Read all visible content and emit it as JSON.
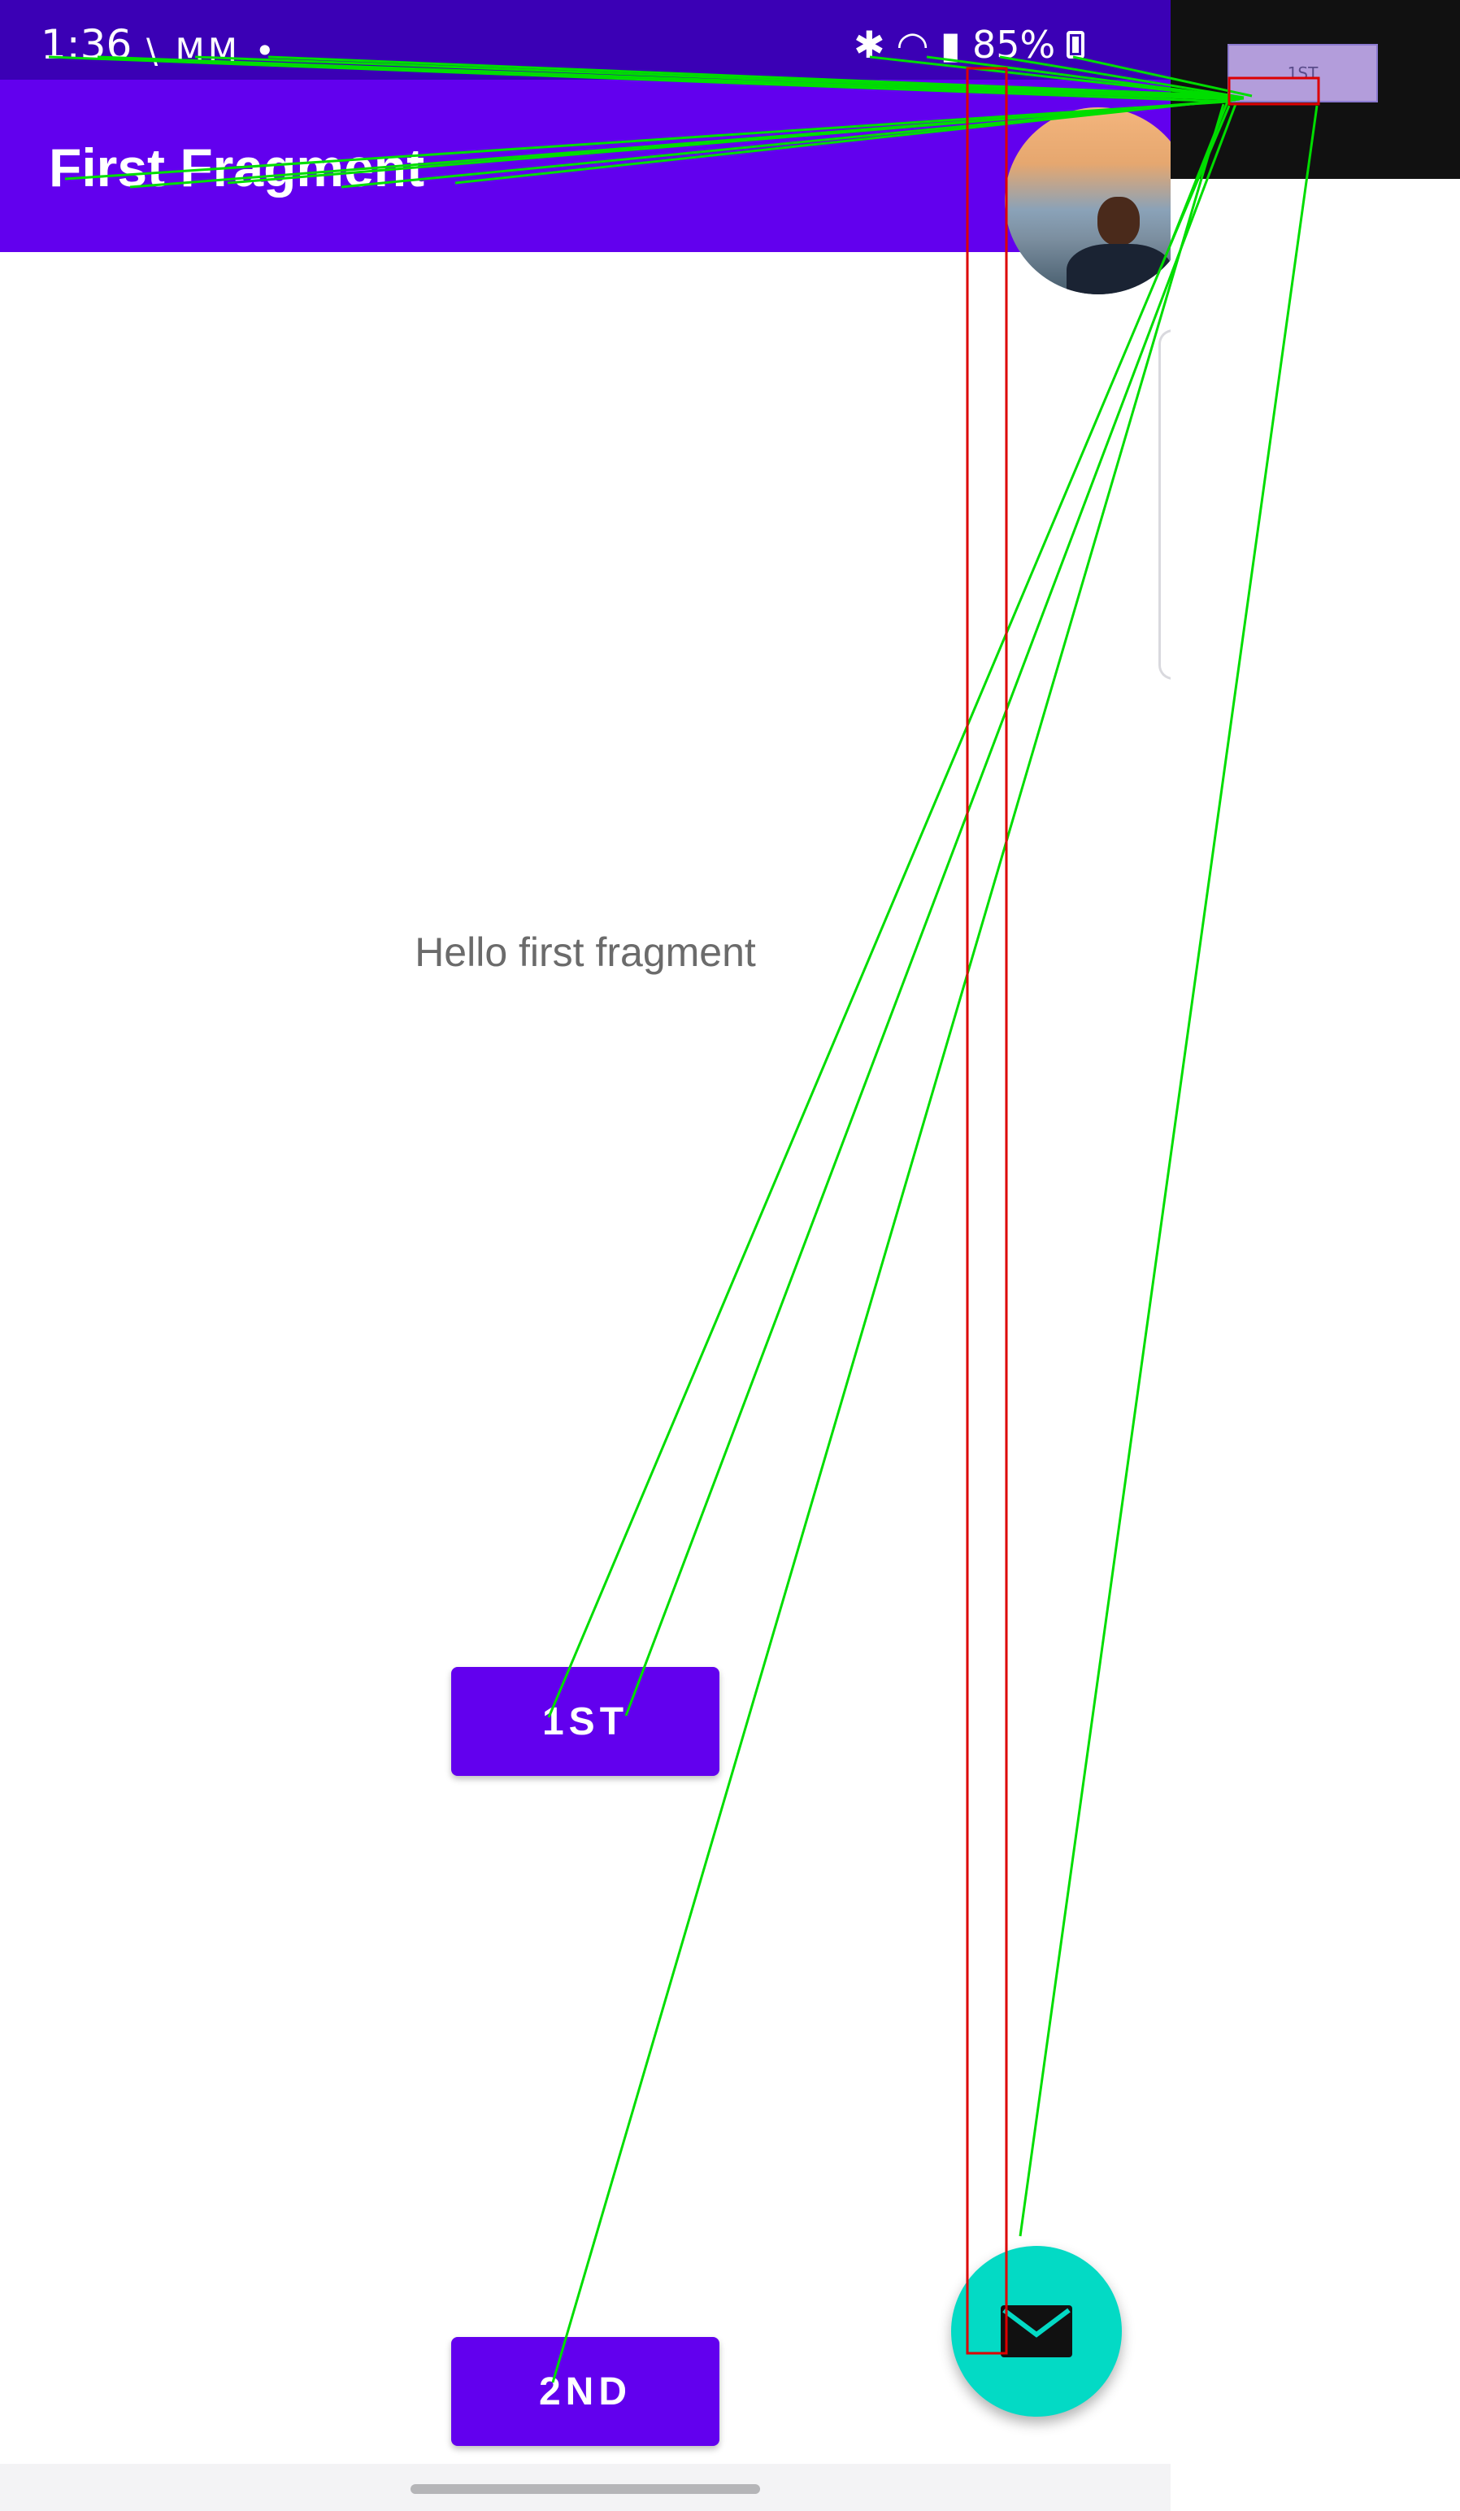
{
  "status_bar": {
    "time": "1:36",
    "left_icons": "\\ MM •",
    "battery": "85%"
  },
  "app_bar": {
    "title": "First Fragment"
  },
  "main": {
    "hello_text": "Hello first fragment"
  },
  "buttons": {
    "first_label": "1ST",
    "second_label": "2ND"
  },
  "fab": {
    "icon": "mail-icon"
  },
  "side_preview": {
    "label": "1ST"
  },
  "colors": {
    "primary": "#6200ee",
    "primary_dark": "#3b00b5",
    "fab": "#03dac5"
  }
}
